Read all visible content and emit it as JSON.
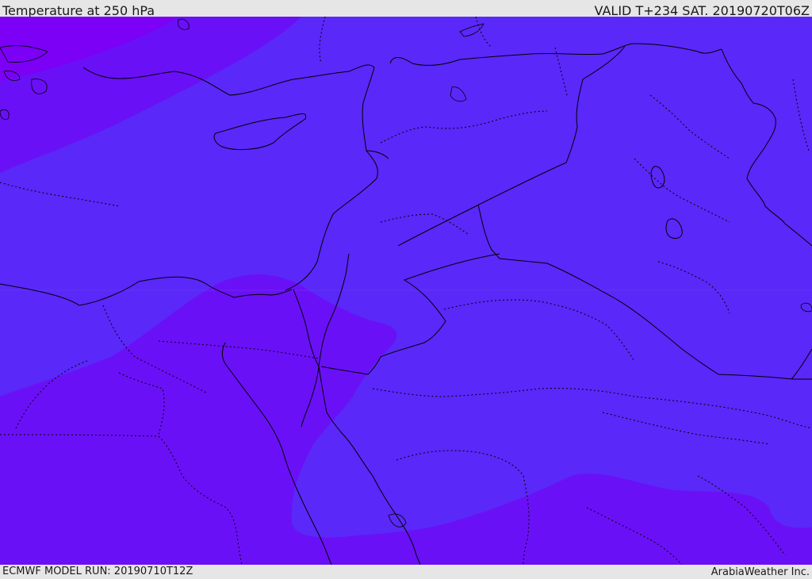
{
  "header": {
    "title": "Temperature at 250 hPa",
    "valid": "VALID T+234 SAT. 20190720T06Z"
  },
  "footer": {
    "model_run": "ECMWF MODEL RUN: 20190710T12Z",
    "credit": "ArabiaWeather Inc."
  },
  "colors": {
    "band_cold": "#7b00f5",
    "band_mid": "#6a10f6",
    "band_base": "#5a28f8",
    "border": "#000000",
    "frame": "#e6e6e6"
  }
}
